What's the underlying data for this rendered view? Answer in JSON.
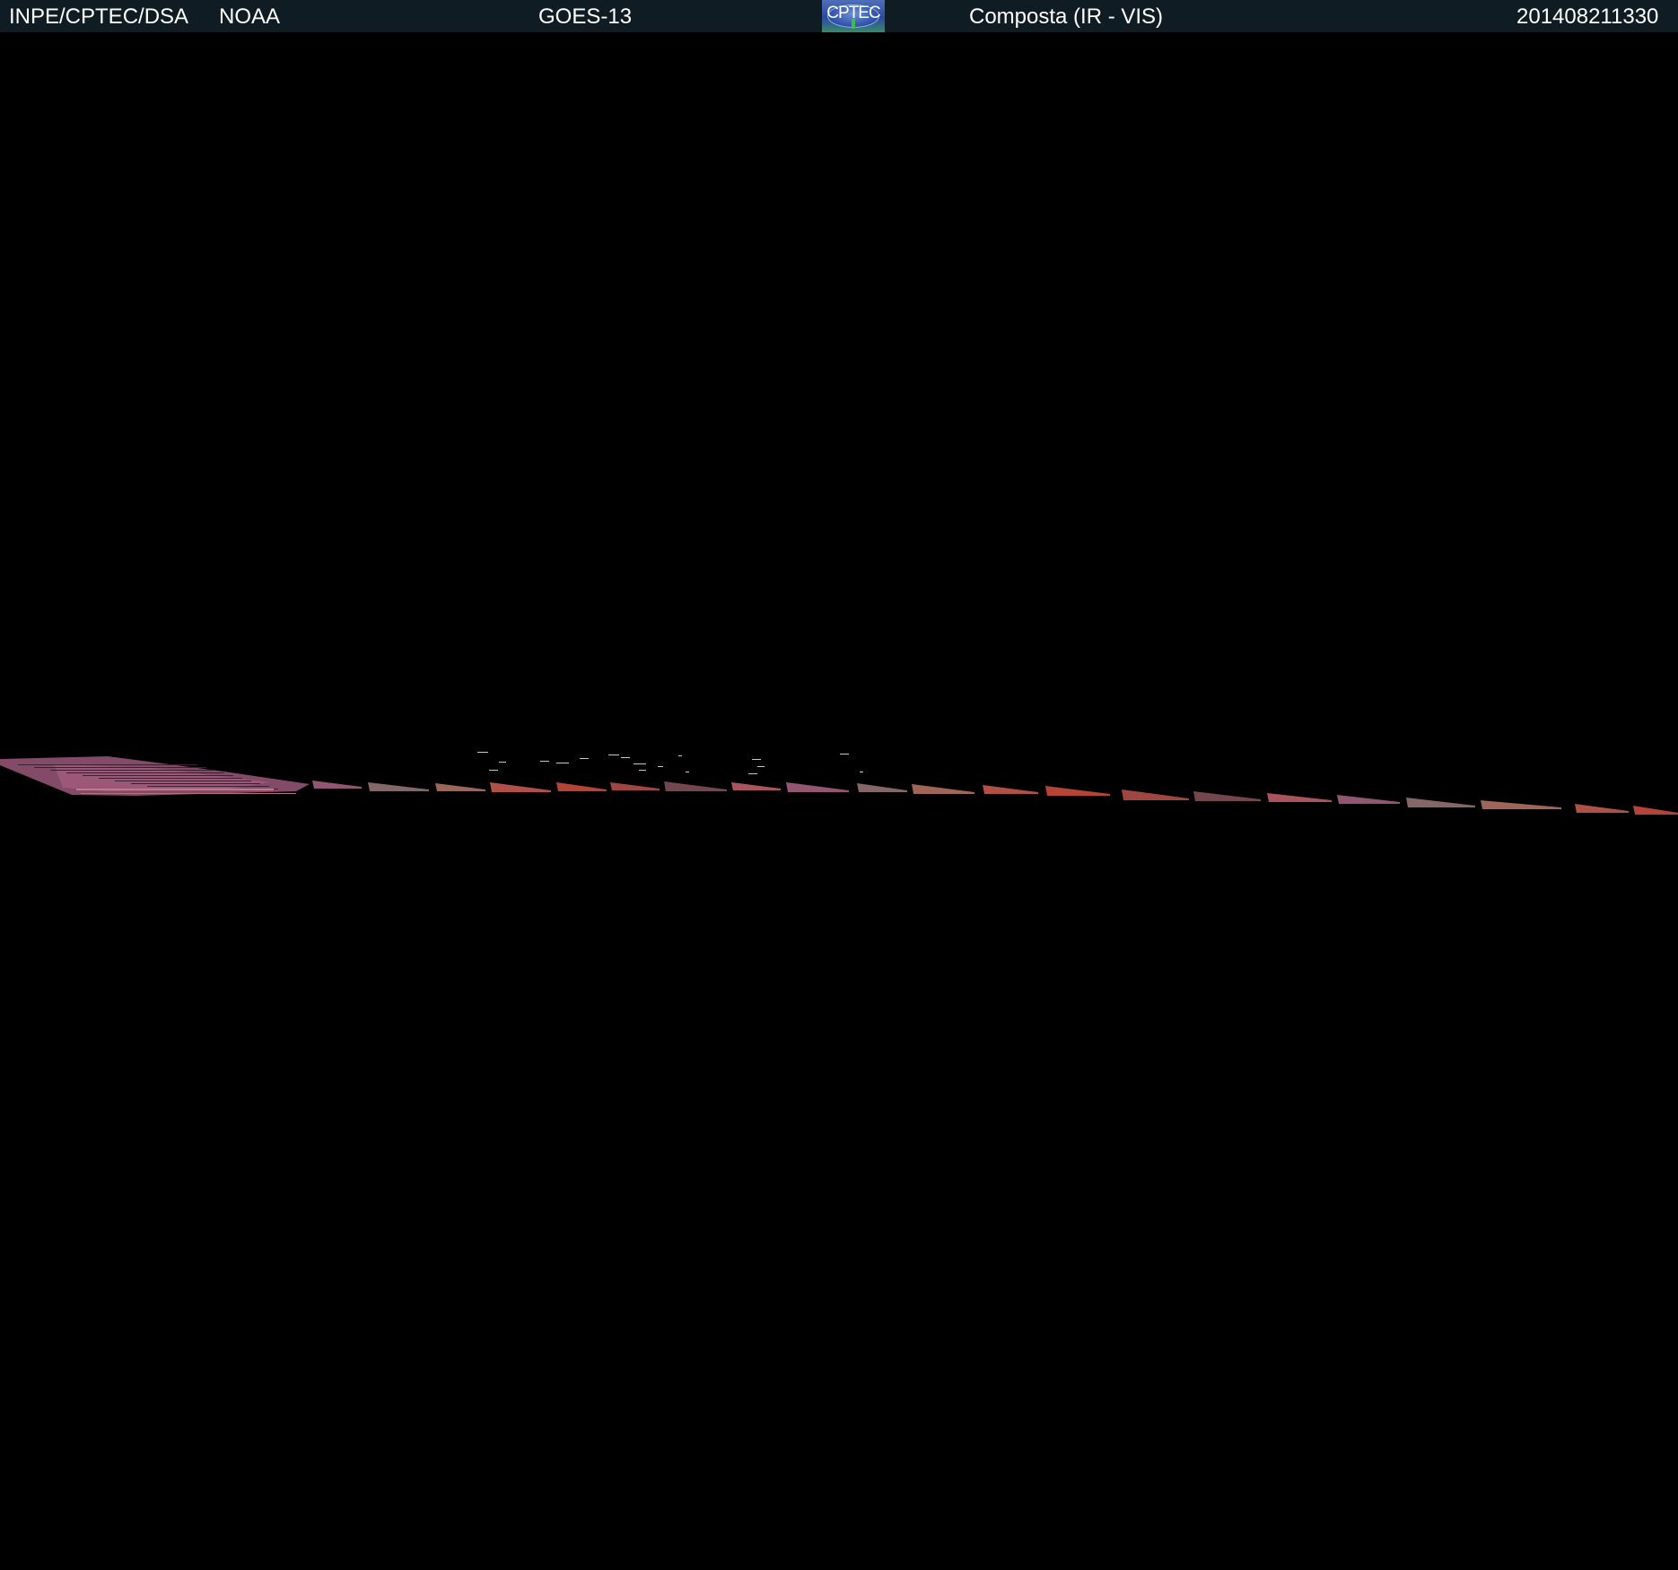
{
  "header": {
    "agency": "INPE/CPTEC/DSA",
    "source": "NOAA",
    "satellite": "GOES-13",
    "logo_text": "CPTEC",
    "product": "Composta (IR - VIS)",
    "timestamp": "201408211330"
  },
  "colors": {
    "background": "#000000",
    "header_bg": "#101c24",
    "header_text": "#ffffff",
    "strip_colors": [
      "#9a5a78",
      "#8d6b6b",
      "#a86a5c",
      "#b8554a",
      "#c0473a",
      "#a94a45",
      "#7a4b52",
      "#b35a63"
    ]
  },
  "imagery": {
    "content": "composite IR-VIS satellite imagery band"
  }
}
